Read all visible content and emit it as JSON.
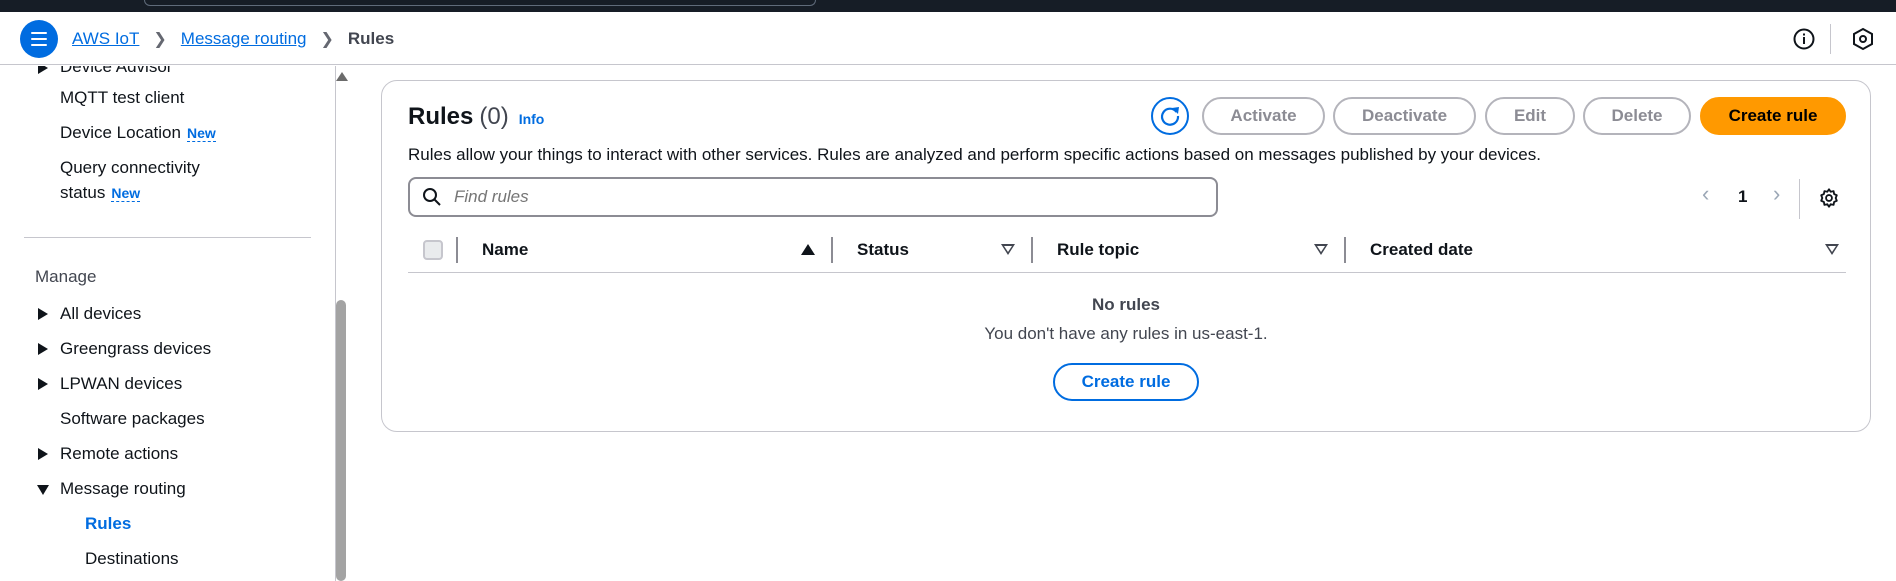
{
  "breadcrumb": {
    "items": [
      "AWS IoT",
      "Message routing"
    ],
    "current": "Rules"
  },
  "sidebar": {
    "items_top": [
      {
        "label": "Device Advisor"
      },
      {
        "label": "MQTT test client"
      },
      {
        "label": "Device Location",
        "badge": "New"
      },
      {
        "label_line1": "Query connectivity",
        "label_line2": "status",
        "badge": "New"
      }
    ],
    "section": "Manage",
    "manage_items": [
      {
        "label": "All devices",
        "expandable": true
      },
      {
        "label": "Greengrass devices",
        "expandable": true
      },
      {
        "label": "LPWAN devices",
        "expandable": true
      },
      {
        "label": "Software packages",
        "expandable": false
      },
      {
        "label": "Remote actions",
        "expandable": true
      },
      {
        "label": "Message routing",
        "expanded": true
      }
    ],
    "sub_items": [
      {
        "label": "Rules",
        "active": true
      },
      {
        "label": "Destinations"
      }
    ]
  },
  "panel": {
    "title": "Rules",
    "count": "(0)",
    "info": "Info",
    "description": "Rules allow your things to interact with other services. Rules are analyzed and perform specific actions based on messages published by your devices.",
    "buttons": {
      "activate": "Activate",
      "deactivate": "Deactivate",
      "edit": "Edit",
      "delete": "Delete",
      "create": "Create rule"
    },
    "search_placeholder": "Find rules",
    "page": "1",
    "columns": [
      "Name",
      "Status",
      "Rule topic",
      "Created date"
    ],
    "empty_title": "No rules",
    "empty_text": "You don't have any rules in us-east-1.",
    "empty_button": "Create rule"
  },
  "colors": {
    "accent": "#006ce0",
    "primary_button": "#ff9900",
    "top_bar": "#161d26"
  }
}
